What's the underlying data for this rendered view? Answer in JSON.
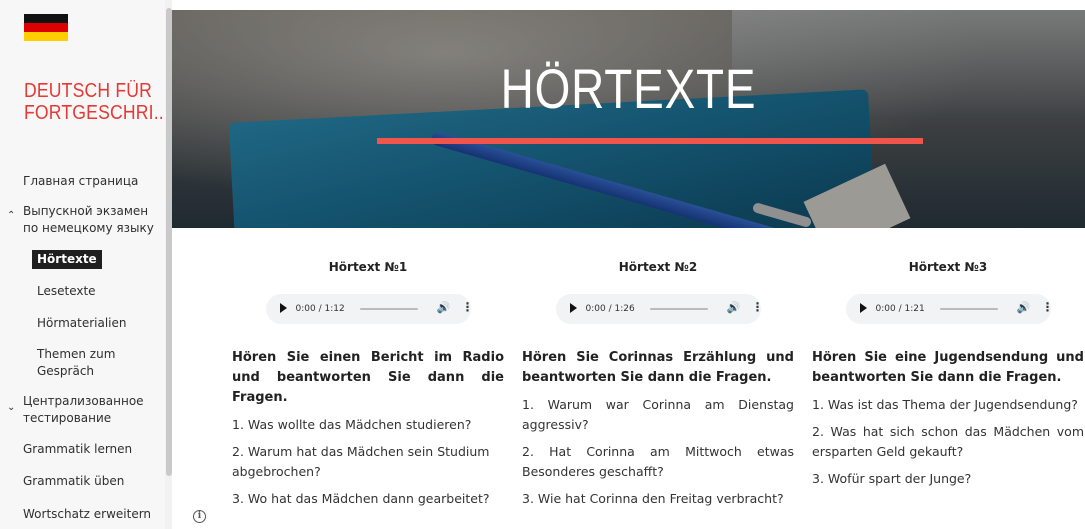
{
  "colors": {
    "accent": "#e53935",
    "underline": "#f0544a",
    "selected_bg": "#1f1f1f"
  },
  "sidebar": {
    "site_title_line1": "DEUTSCH FÜR",
    "site_title_line2": "FORTGESCHRI...",
    "items": [
      {
        "label": "Главная страница"
      },
      {
        "label": "Выпускной экзамен",
        "label2": "по немецкому языку",
        "icon": "chevron-up-icon"
      },
      {
        "label": "Hörtexte",
        "selected": true
      },
      {
        "label": "Lesetexte"
      },
      {
        "label": "Hörmaterialien"
      },
      {
        "label": "Themen zum",
        "label2": "Gespräch"
      },
      {
        "label": "Централизованное",
        "label2": "тестирование",
        "icon": "chevron-down-icon"
      },
      {
        "label": "Grammatik lernen"
      },
      {
        "label": "Grammatik üben"
      },
      {
        "label": "Wortschatz erweitern"
      }
    ]
  },
  "hero": {
    "title": "HÖRTEXTE"
  },
  "columns": [
    {
      "title": "Hörtext №1",
      "player_time": "0:00 / 1:12",
      "intro": "Hören Sie einen Bericht im Radio und beantworten Sie dann die Fragen.",
      "questions": [
        "1. Was wollte das Mädchen studieren?",
        "2. Warum hat das Mädchen sein Studium abgebrochen?",
        "3. Wo hat das Mädchen dann gearbeitet?"
      ]
    },
    {
      "title": "Hörtext №2",
      "player_time": "0:00 / 1:26",
      "intro": "Hören Sie Corinnas Erzählung und beantworten Sie dann die Fragen.",
      "questions": [
        "1. Warum war Corinna am Dienstag aggressiv?",
        "2. Hat Corinna am Mittwoch etwas Besonderes geschafft?",
        "3. Wie hat Corinna den Freitag verbracht?"
      ]
    },
    {
      "title": "Hörtext №3",
      "player_time": "0:00 / 1:21",
      "intro": "Hören Sie eine Jugendsendung und beantworten Sie dann die Fragen.",
      "questions": [
        "1. Was ist das Thema der Jugendsendung?",
        "2. Was hat sich schon das Mädchen vom ersparten Geld gekauft?",
        "3. Wofür spart der Junge?"
      ]
    }
  ]
}
